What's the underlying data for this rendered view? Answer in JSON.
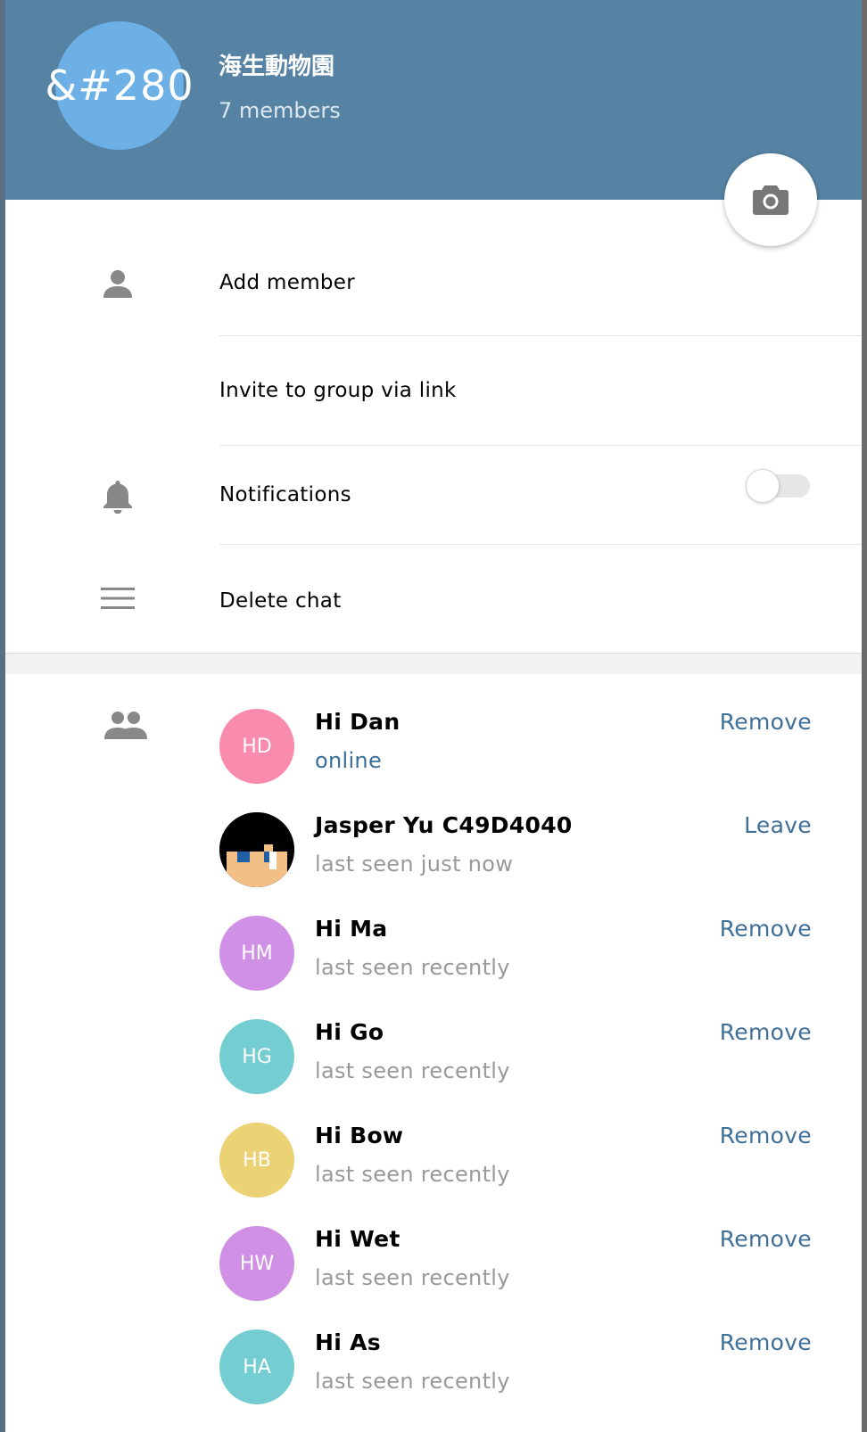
{
  "group": {
    "avatar_text": "&#280",
    "title": "海生動物園",
    "members_count": "7 members",
    "avatar_color": "#6cb0e6",
    "header_color": "#5682a3"
  },
  "menu": {
    "add_member": "Add member",
    "invite_link": "Invite to group via link",
    "notifications": "Notifications",
    "notifications_enabled": false,
    "delete_chat": "Delete chat"
  },
  "members": [
    {
      "initials": "HD",
      "name": "Hi Dan",
      "status": "online",
      "action": "Remove",
      "color": "#f98bad"
    },
    {
      "initials": "",
      "name": "Jasper Yu C49D4040",
      "status": "last seen just now",
      "action": "Leave",
      "color": "#000000"
    },
    {
      "initials": "HM",
      "name": "Hi Ma",
      "status": "last seen recently",
      "action": "Remove",
      "color": "#cf90e5"
    },
    {
      "initials": "HG",
      "name": "Hi Go",
      "status": "last seen recently",
      "action": "Remove",
      "color": "#74cdd0"
    },
    {
      "initials": "HB",
      "name": "Hi Bow",
      "status": "last seen recently",
      "action": "Remove",
      "color": "#ebd274"
    },
    {
      "initials": "HW",
      "name": "Hi Wet",
      "status": "last seen recently",
      "action": "Remove",
      "color": "#cf90e5"
    },
    {
      "initials": "HA",
      "name": "Hi As",
      "status": "last seen recently",
      "action": "Remove",
      "color": "#74cdd0"
    }
  ],
  "icons": {
    "camera": "camera-icon",
    "add_member": "person-icon",
    "notifications": "bell-icon",
    "delete_chat": "menu-lines-icon",
    "members": "people-icon"
  },
  "colors": {
    "link": "#3f6f98",
    "online": "#3b6f99",
    "muted": "#999999"
  }
}
